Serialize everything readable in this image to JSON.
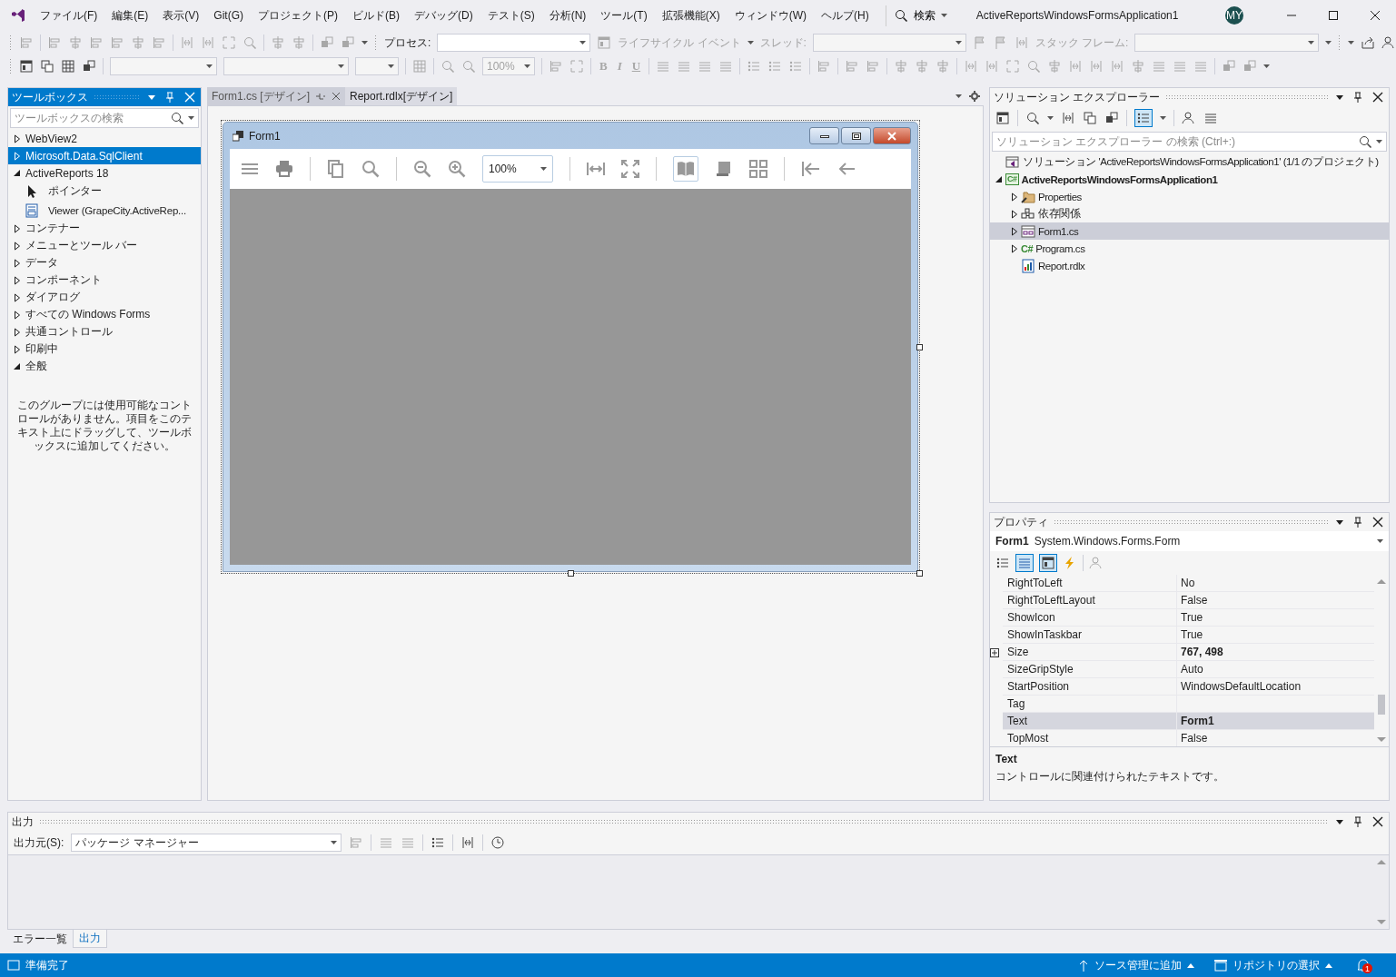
{
  "menu": {
    "items": [
      "ファイル(F)",
      "編集(E)",
      "表示(V)",
      "Git(G)",
      "プロジェクト(P)",
      "ビルド(B)",
      "デバッグ(D)",
      "テスト(S)",
      "分析(N)",
      "ツール(T)",
      "拡張機能(X)",
      "ウィンドウ(W)",
      "ヘルプ(H)"
    ],
    "search": "検索",
    "solution_title": "ActiveReportsWindowsFormsApplication1",
    "avatar": "MY"
  },
  "toolbar": {
    "process_label": "プロセス:",
    "lifecycle_label": "ライフサイクル イベント",
    "thread_label": "スレッド:",
    "stack_label": "スタック フレーム:",
    "zoom": "100%",
    "format_buttons": [
      "B",
      "I",
      "U"
    ]
  },
  "toolbox": {
    "title": "ツールボックス",
    "search_placeholder": "ツールボックスの検索",
    "items": [
      {
        "label": "WebView2",
        "expanded": false,
        "selected": false
      },
      {
        "label": "Microsoft.Data.SqlClient",
        "expanded": false,
        "selected": true
      },
      {
        "label": "ActiveReports 18",
        "expanded": true,
        "selected": false,
        "children": [
          {
            "label": "ポインター",
            "kind": "pointer"
          },
          {
            "label": "Viewer (GrapeCity.ActiveRep...",
            "kind": "viewer"
          }
        ]
      },
      {
        "label": "コンテナー",
        "expanded": false,
        "selected": false
      },
      {
        "label": "メニューとツール バー",
        "expanded": false,
        "selected": false
      },
      {
        "label": "データ",
        "expanded": false,
        "selected": false
      },
      {
        "label": "コンポーネント",
        "expanded": false,
        "selected": false
      },
      {
        "label": "ダイアログ",
        "expanded": false,
        "selected": false
      },
      {
        "label": "すべての Windows Forms",
        "expanded": false,
        "selected": false
      },
      {
        "label": "共通コントロール",
        "expanded": false,
        "selected": false
      },
      {
        "label": "印刷中",
        "expanded": false,
        "selected": false
      },
      {
        "label": "全般",
        "expanded": true,
        "selected": false
      }
    ],
    "empty_message": "このグループには使用可能なコントロールがありません。項目をこのテキスト上にドラッグして、ツールボックスに追加してください。"
  },
  "tabs": [
    {
      "label": "Form1.cs [デザイン]",
      "selected": true
    },
    {
      "label": "Report.rdlx[デザイン]",
      "selected": false
    }
  ],
  "form": {
    "title": "Form1",
    "zoom": "100%"
  },
  "solution_explorer": {
    "title": "ソリューション エクスプローラー",
    "search_placeholder": "ソリューション エクスプローラー の検索 (Ctrl+:)",
    "tree": [
      {
        "label": "ソリューション 'ActiveReportsWindowsFormsApplication1' (1/1 のプロジェクト)",
        "kind": "solution",
        "expandable": false,
        "selected": false,
        "children": [
          {
            "label": "ActiveReportsWindowsFormsApplication1",
            "kind": "project",
            "icon_text": "C#",
            "expandable": true,
            "expanded": true,
            "selected": false,
            "children": [
              {
                "label": "Properties",
                "kind": "properties",
                "expandable": true,
                "expanded": false,
                "selected": false
              },
              {
                "label": "依存関係",
                "kind": "dependencies",
                "expandable": true,
                "expanded": false,
                "selected": false
              },
              {
                "label": "Form1.cs",
                "kind": "form",
                "expandable": true,
                "expanded": false,
                "selected": true
              },
              {
                "label": "Program.cs",
                "kind": "csharp",
                "icon_text": "C#",
                "expandable": true,
                "expanded": false,
                "selected": false
              },
              {
                "label": "Report.rdlx",
                "kind": "report",
                "expandable": false,
                "expanded": false,
                "selected": false
              }
            ]
          }
        ]
      }
    ]
  },
  "properties": {
    "title": "プロパティ",
    "object_name": "Form1",
    "object_type": "System.Windows.Forms.Form",
    "rows": [
      {
        "name": "RightToLeft",
        "value": "No",
        "expandable": false,
        "selected": false
      },
      {
        "name": "RightToLeftLayout",
        "value": "False",
        "expandable": false,
        "selected": false
      },
      {
        "name": "ShowIcon",
        "value": "True",
        "expandable": false,
        "selected": false
      },
      {
        "name": "ShowInTaskbar",
        "value": "True",
        "expandable": false,
        "selected": false
      },
      {
        "name": "Size",
        "value": "767, 498",
        "expandable": true,
        "modified": true,
        "selected": false
      },
      {
        "name": "SizeGripStyle",
        "value": "Auto",
        "expandable": false,
        "selected": false
      },
      {
        "name": "StartPosition",
        "value": "WindowsDefaultLocation",
        "expandable": false,
        "selected": false
      },
      {
        "name": "Tag",
        "expandable": false,
        "selected": false
      },
      {
        "name": "Text",
        "value": "Form1",
        "expandable": false,
        "modified": true,
        "selected": true
      },
      {
        "name": "TopMost",
        "value": "False",
        "expandable": false,
        "selected": false
      }
    ],
    "description_title": "Text",
    "description": "コントロールに関連付けられたテキストです。"
  },
  "output": {
    "title": "出力",
    "source_label": "出力元(S):",
    "source_value": "パッケージ マネージャー",
    "tabs": [
      {
        "label": "エラー一覧",
        "selected": false
      },
      {
        "label": "出力",
        "selected": true
      }
    ]
  },
  "status_bar": {
    "ready": "準備完了",
    "source_control": "ソース管理に追加",
    "repository": "リポジトリの選択",
    "notifications": "1"
  }
}
